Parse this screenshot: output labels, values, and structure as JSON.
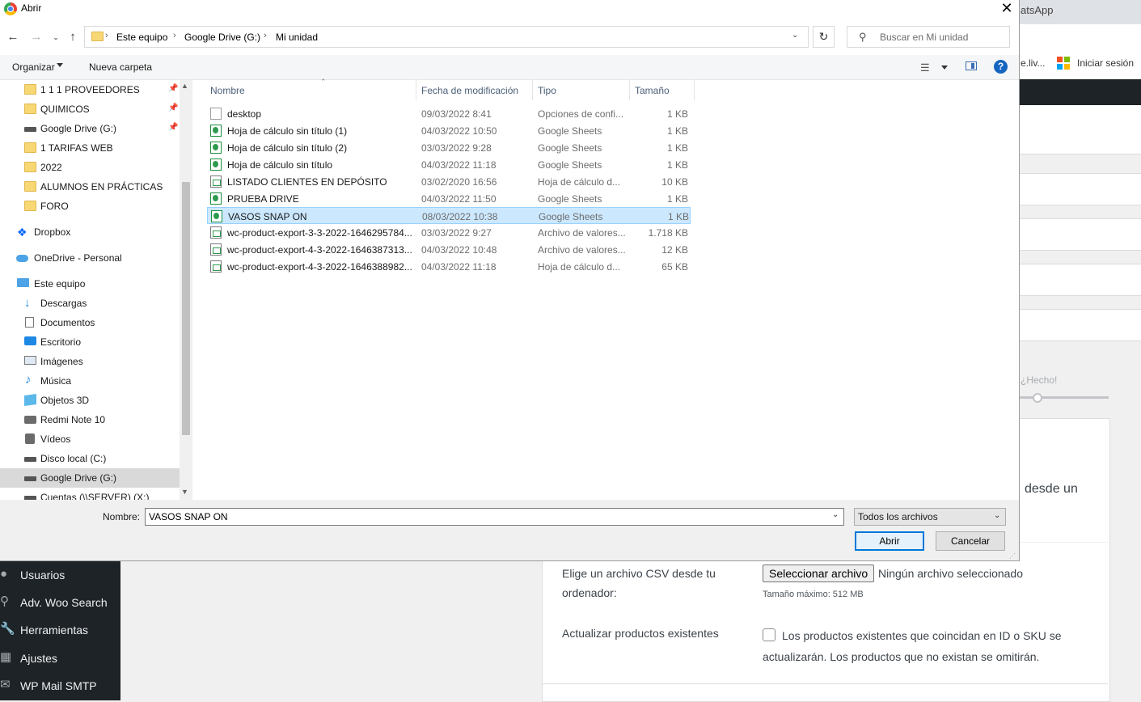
{
  "background": {
    "browser_tab": "atsApp",
    "bookmark_partial": "e.liv...",
    "bookmark_login": "Iniciar sesión",
    "ms_colors": [
      "#f25022",
      "#7fba00",
      "#00a4ef",
      "#ffb900"
    ],
    "hecho": "¿Hecho!",
    "desde_un": "desde un",
    "csv_label": "Elige un archivo CSV desde tu ordenador:",
    "select_file_button": "Seleccionar archivo",
    "no_file": "Ningún archivo seleccionado",
    "max_size": "Tamaño máximo: 512 MB",
    "update_label": "Actualizar productos existentes",
    "update_desc": "Los productos existentes que coincidan en ID o SKU se actualizarán. Los productos que no existan se omitirán.",
    "sidebar": [
      {
        "label": "Usuarios",
        "icon": "users-icon"
      },
      {
        "label": "Adv. Woo Search",
        "icon": "search-icon"
      },
      {
        "label": "Herramientas",
        "icon": "wrench-icon"
      },
      {
        "label": "Ajustes",
        "icon": "settings-icon"
      },
      {
        "label": "WP Mail SMTP",
        "icon": "mail-icon"
      }
    ]
  },
  "dialog": {
    "title": "Abrir",
    "breadcrumb": [
      "Este equipo",
      "Google Drive (G:)",
      "Mi unidad"
    ],
    "search_placeholder": "Buscar en Mi unidad",
    "toolbar": {
      "organize": "Organizar",
      "new_folder": "Nueva carpeta"
    },
    "nav_items": [
      {
        "label": "1 1 1 PROVEEDORES",
        "icon": "folder-icon",
        "pinned": true
      },
      {
        "label": "QUIMICOS",
        "icon": "folder-icon",
        "pinned": true
      },
      {
        "label": "Google Drive (G:)",
        "icon": "drive-icon",
        "pinned": true
      },
      {
        "label": "1 TARIFAS WEB",
        "icon": "folder-icon",
        "pinned": false
      },
      {
        "label": "2022",
        "icon": "folder-icon",
        "pinned": false
      },
      {
        "label": "ALUMNOS EN PRÁCTICAS",
        "icon": "folder-icon",
        "pinned": false
      },
      {
        "label": "FORO",
        "icon": "folder-icon",
        "pinned": false
      },
      {
        "label": "Dropbox",
        "icon": "dropbox-icon",
        "pinned": false
      },
      {
        "label": "OneDrive - Personal",
        "icon": "onedrive-icon",
        "pinned": false
      },
      {
        "label": "Este equipo",
        "icon": "computer-icon",
        "pinned": false
      },
      {
        "label": "Descargas",
        "icon": "downloads-icon",
        "pinned": false
      },
      {
        "label": "Documentos",
        "icon": "documents-icon",
        "pinned": false
      },
      {
        "label": "Escritorio",
        "icon": "desktop-icon",
        "pinned": false
      },
      {
        "label": "Imágenes",
        "icon": "pictures-icon",
        "pinned": false
      },
      {
        "label": "Música",
        "icon": "music-icon",
        "pinned": false
      },
      {
        "label": "Objetos 3D",
        "icon": "3d-objects-icon",
        "pinned": false
      },
      {
        "label": "Redmi Note 10",
        "icon": "phone-icon",
        "pinned": false
      },
      {
        "label": "Vídeos",
        "icon": "videos-icon",
        "pinned": false
      },
      {
        "label": "Disco local (C:)",
        "icon": "drive-icon",
        "pinned": false
      },
      {
        "label": "Google Drive (G:)",
        "icon": "drive-icon",
        "pinned": false,
        "selected": true
      },
      {
        "label": "Cuentas (\\\\SERVER) (X:)",
        "icon": "network-drive-icon",
        "pinned": false
      }
    ],
    "columns": {
      "name": "Nombre",
      "date": "Fecha de modificación",
      "type": "Tipo",
      "size": "Tamaño"
    },
    "files": [
      {
        "name": "desktop",
        "date": "09/03/2022 8:41",
        "type": "Opciones de confi...",
        "size": "1 KB",
        "icon": "settings-file-icon"
      },
      {
        "name": "Hoja de cálculo sin título (1)",
        "date": "04/03/2022 10:50",
        "type": "Google Sheets",
        "size": "1 KB",
        "icon": "google-sheets-icon"
      },
      {
        "name": "Hoja de cálculo sin título (2)",
        "date": "03/03/2022 9:28",
        "type": "Google Sheets",
        "size": "1 KB",
        "icon": "google-sheets-icon"
      },
      {
        "name": "Hoja de cálculo sin título",
        "date": "04/03/2022 11:18",
        "type": "Google Sheets",
        "size": "1 KB",
        "icon": "google-sheets-icon"
      },
      {
        "name": "LISTADO CLIENTES EN DEPÓSITO",
        "date": "03/02/2020 16:56",
        "type": "Hoja de cálculo d...",
        "size": "10 KB",
        "icon": "spreadsheet-icon"
      },
      {
        "name": "PRUEBA DRIVE",
        "date": "04/03/2022 11:50",
        "type": "Google Sheets",
        "size": "1 KB",
        "icon": "google-sheets-icon"
      },
      {
        "name": "VASOS SNAP ON",
        "date": "08/03/2022 10:38",
        "type": "Google Sheets",
        "size": "1 KB",
        "icon": "google-sheets-icon",
        "selected": true
      },
      {
        "name": "wc-product-export-3-3-2022-1646295784...",
        "date": "03/03/2022 9:27",
        "type": "Archivo de valores...",
        "size": "1.718 KB",
        "icon": "csv-icon"
      },
      {
        "name": "wc-product-export-4-3-2022-1646387313...",
        "date": "04/03/2022 10:48",
        "type": "Archivo de valores...",
        "size": "12 KB",
        "icon": "csv-icon"
      },
      {
        "name": "wc-product-export-4-3-2022-1646388982...",
        "date": "04/03/2022 11:18",
        "type": "Hoja de cálculo d...",
        "size": "65 KB",
        "icon": "spreadsheet-icon"
      }
    ],
    "filename_label": "Nombre:",
    "filename_value": "VASOS SNAP ON",
    "filter": "Todos los archivos",
    "open_button": "Abrir",
    "cancel_button": "Cancelar"
  }
}
